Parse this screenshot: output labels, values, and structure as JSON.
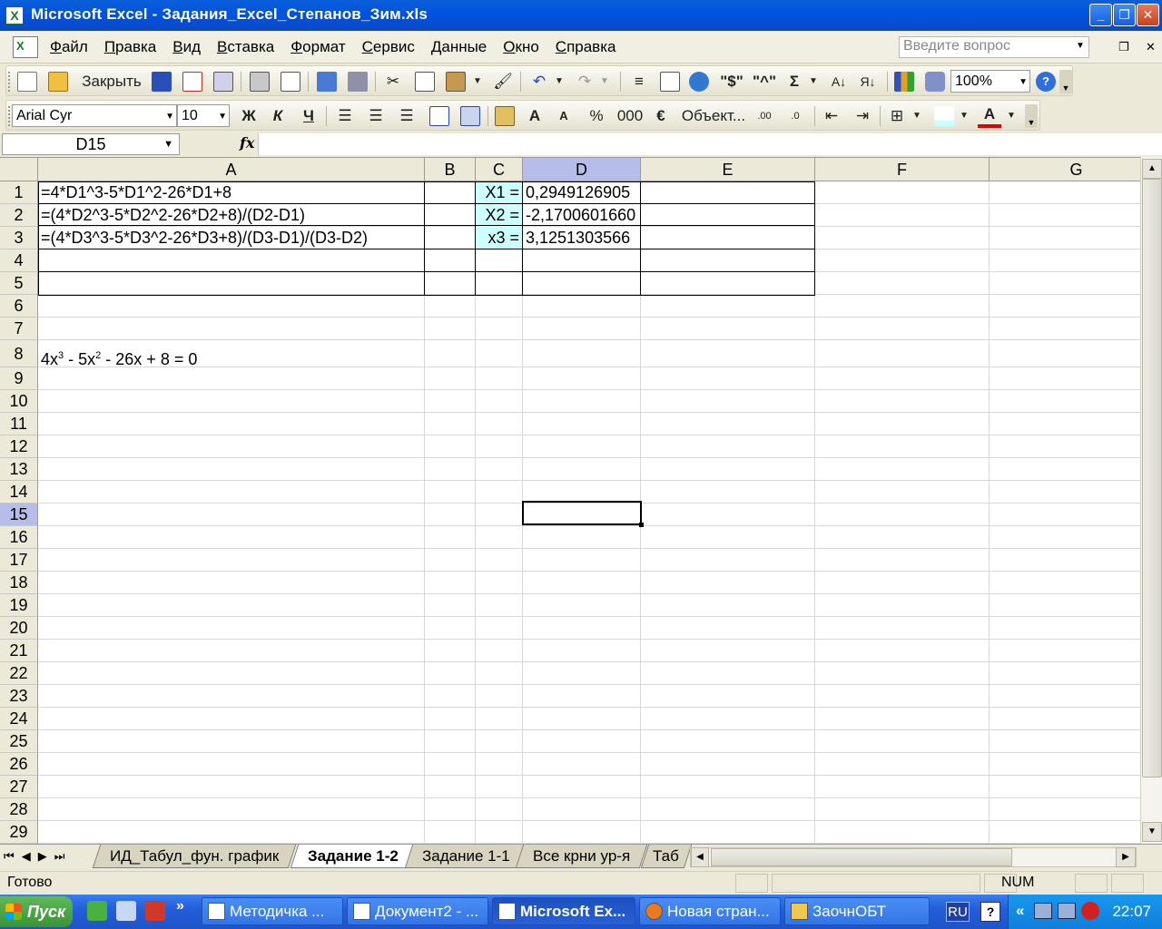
{
  "window": {
    "title": "Microsoft Excel - Задания_Excel_Степанов_Зим.xls",
    "app_icon": "excel-icon"
  },
  "menu": {
    "items": [
      "Файл",
      "Правка",
      "Вид",
      "Вставка",
      "Формат",
      "Сервис",
      "Данные",
      "Окно",
      "Справка"
    ],
    "ask_placeholder": "Введите вопрос"
  },
  "toolbar": {
    "close_label": "Закрыть",
    "zoom": "100%",
    "sigma": "Σ",
    "currency_sign": "\"$\"",
    "caret_sign": "\"^\""
  },
  "format_toolbar": {
    "font": "Arial Cyr",
    "size": "10",
    "bold": "Ж",
    "italic": "К",
    "underline": "Ч",
    "percent": "%",
    "thousands": "000",
    "euro": "€",
    "object_label": "Объект...",
    "font_color_letter": "A"
  },
  "formula_bar": {
    "name_box": "D15",
    "fx": "fx",
    "formula": ""
  },
  "sheet": {
    "columns": [
      "A",
      "B",
      "C",
      "D",
      "E",
      "F",
      "G"
    ],
    "rows": [
      "1",
      "2",
      "3",
      "4",
      "5",
      "6",
      "7",
      "8",
      "9",
      "10",
      "11",
      "12",
      "13",
      "14",
      "15",
      "16",
      "17",
      "18",
      "19",
      "20",
      "21",
      "22",
      "23",
      "24",
      "25",
      "26",
      "27",
      "28",
      "29"
    ],
    "active_column": "D",
    "active_row": "15",
    "cells": {
      "A1": "=4*D1^3-5*D1^2-26*D1+8",
      "A2": "=(4*D2^3-5*D2^2-26*D2+8)/(D2-D1)",
      "A3": "=(4*D3^3-5*D3^2-26*D3+8)/(D3-D1)/(D3-D2)",
      "C1": "X1 =",
      "C2": "X2 =",
      "C3": "x3 =",
      "D1": "0,2949126905",
      "D2": "-2,1700601660",
      "D3": "3,1251303566",
      "A8_parts": [
        "4x",
        "3",
        " - 5x",
        "2",
        " - 26x + 8 = 0"
      ]
    },
    "label_fill_color": "#ccffff"
  },
  "tabs": {
    "items": [
      "ИД_Табул_фун. график",
      "Задание 1-2",
      "Задание 1-1",
      "Все крни ур-я",
      "Таб"
    ],
    "active": "Задание 1-2"
  },
  "status": {
    "ready": "Готово",
    "num": "NUM"
  },
  "taskbar": {
    "start": "Пуск",
    "tasks": [
      "Методичка ...",
      "Документ2 - ...",
      "Microsoft Ex...",
      "Новая стран...",
      "ЗаочнОБТ"
    ],
    "active_task": "Microsoft Ex...",
    "lang": "RU",
    "help": "?",
    "clock": "22:07",
    "tray_expand": "«",
    "quicklaunch_more": "»"
  }
}
